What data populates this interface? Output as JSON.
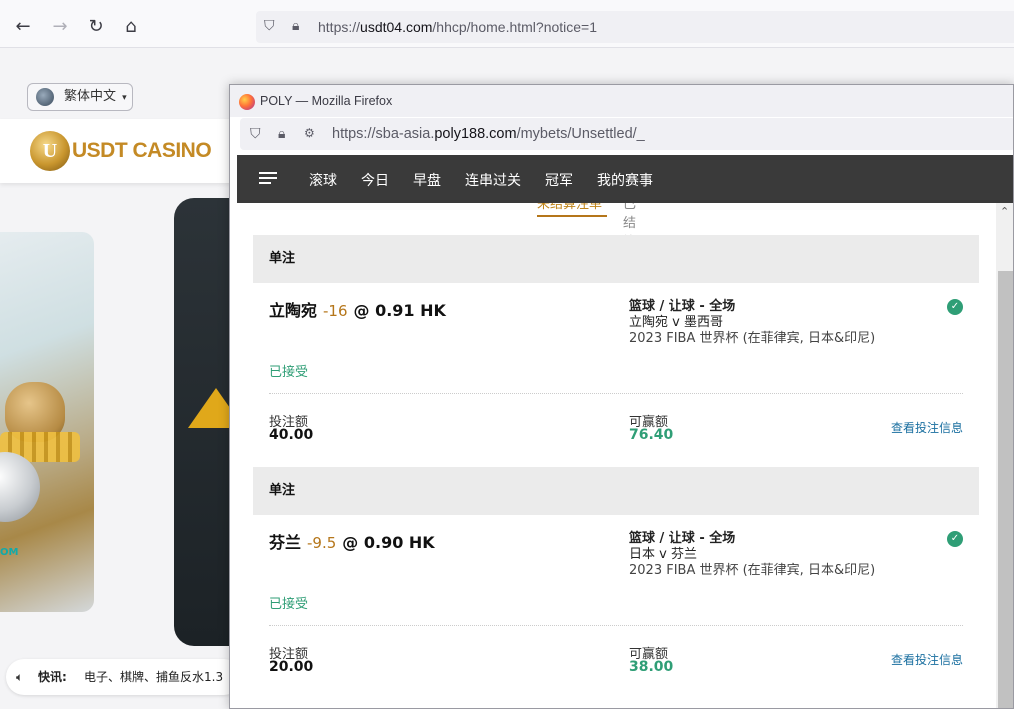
{
  "background_browser": {
    "url_prefix": "https://",
    "url_domain": "usdt04.com",
    "url_path": "/hhcp/home.html?notice=1",
    "language_button": "繁体中文",
    "casino_logo_text": "USDT CASINO",
    "casino_logo_letter": "U",
    "ticker_label": "快讯:",
    "ticker_text": "电子、棋牌、捕鱼反水1.3",
    "promo_partial_text": "OM"
  },
  "firefox_window": {
    "title": "POLY — Mozilla Firefox",
    "url_prefix": "https://sba-asia.",
    "url_domain": "poly188.com",
    "url_path": "/mybets/Unsettled/_"
  },
  "site_nav": {
    "tabs": [
      "滚球",
      "今日",
      "早盘",
      "连串过关",
      "冠军",
      "我的赛事"
    ]
  },
  "sub_tabs": {
    "active": "未结算注单",
    "inactive": "已结算注单"
  },
  "bets": [
    {
      "type": "单注",
      "selection": "立陶宛",
      "handicap": "-16",
      "odds": "@  0.91 HK",
      "market": "篮球 / 让球 - 全场",
      "match": "立陶宛 v 墨西哥",
      "league": "2023 FIBA 世界杯 (在菲律宾, 日本&印尼)",
      "status": "已接受",
      "stake_label": "投注额",
      "stake": "40.00",
      "win_label": "可赢额",
      "win": "76.40",
      "detail_link": "查看投注信息"
    },
    {
      "type": "单注",
      "selection": "芬兰",
      "handicap": "-9.5",
      "odds": "@  0.90 HK",
      "market": "篮球 / 让球 - 全场",
      "match": "日本 v 芬兰",
      "league": "2023 FIBA 世界杯 (在菲律宾, 日本&印尼)",
      "status": "已接受",
      "stake_label": "投注额",
      "stake": "20.00",
      "win_label": "可赢额",
      "win": "38.00",
      "detail_link": "查看投注信息"
    }
  ],
  "colors": {
    "accent_gold": "#b5761a",
    "win_green": "#2f9e76",
    "link_blue": "#1a6fa0",
    "nav_dark": "#3a3a3a"
  }
}
